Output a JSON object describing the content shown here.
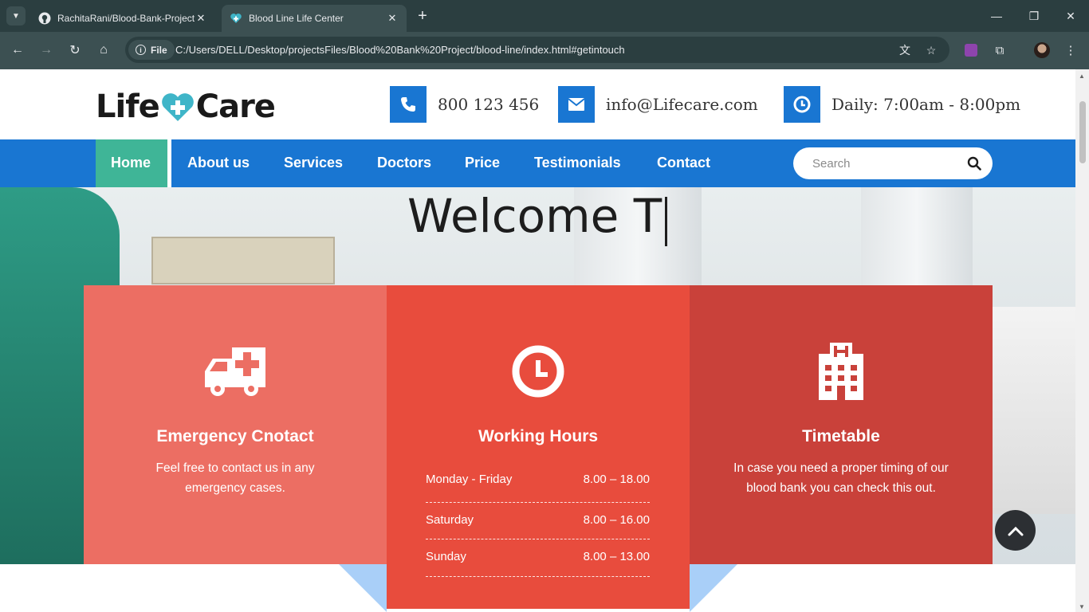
{
  "browser": {
    "tabs": [
      {
        "title": "RachitaRani/Blood-Bank-Project",
        "icon": "github-icon",
        "active": false
      },
      {
        "title": "Blood Line Life Center",
        "icon": "site-favicon",
        "active": true
      }
    ],
    "address": {
      "chip_label": "File",
      "url": "C:/Users/DELL/Desktop/projectsFiles/Blood%20Bank%20Project/blood-line/index.html#getintouch"
    }
  },
  "header": {
    "logo": {
      "left": "Life",
      "right": "Care"
    },
    "phone": "800 123 456",
    "email": "info@Lifecare.com",
    "hours": "Daily: 7:00am - 8:00pm"
  },
  "nav": {
    "items": [
      "Home",
      "About us",
      "Services",
      "Doctors",
      "Price",
      "Testimonials",
      "Contact"
    ],
    "active": "Home",
    "search_placeholder": "Search"
  },
  "hero": {
    "headline": "Welcome T"
  },
  "cards": {
    "emergency": {
      "title": "Emergency Cnotact",
      "text": "Feel free to contact us in any emergency cases."
    },
    "working_hours": {
      "title": "Working Hours",
      "rows": [
        {
          "day": "Monday - Friday",
          "time": "8.00 – 18.00"
        },
        {
          "day": "Saturday",
          "time": "8.00 – 16.00"
        },
        {
          "day": "Sunday",
          "time": "8.00 – 13.00"
        }
      ]
    },
    "timetable": {
      "title": "Timetable",
      "text": "In case you need a proper timing of our blood bank you can check this out."
    }
  },
  "colors": {
    "primary_blue": "#1976d2",
    "active_green": "#3fb597",
    "card_light_red": "#ec6e63",
    "card_red": "#e84c3d",
    "card_dark_red": "#c9413a"
  }
}
